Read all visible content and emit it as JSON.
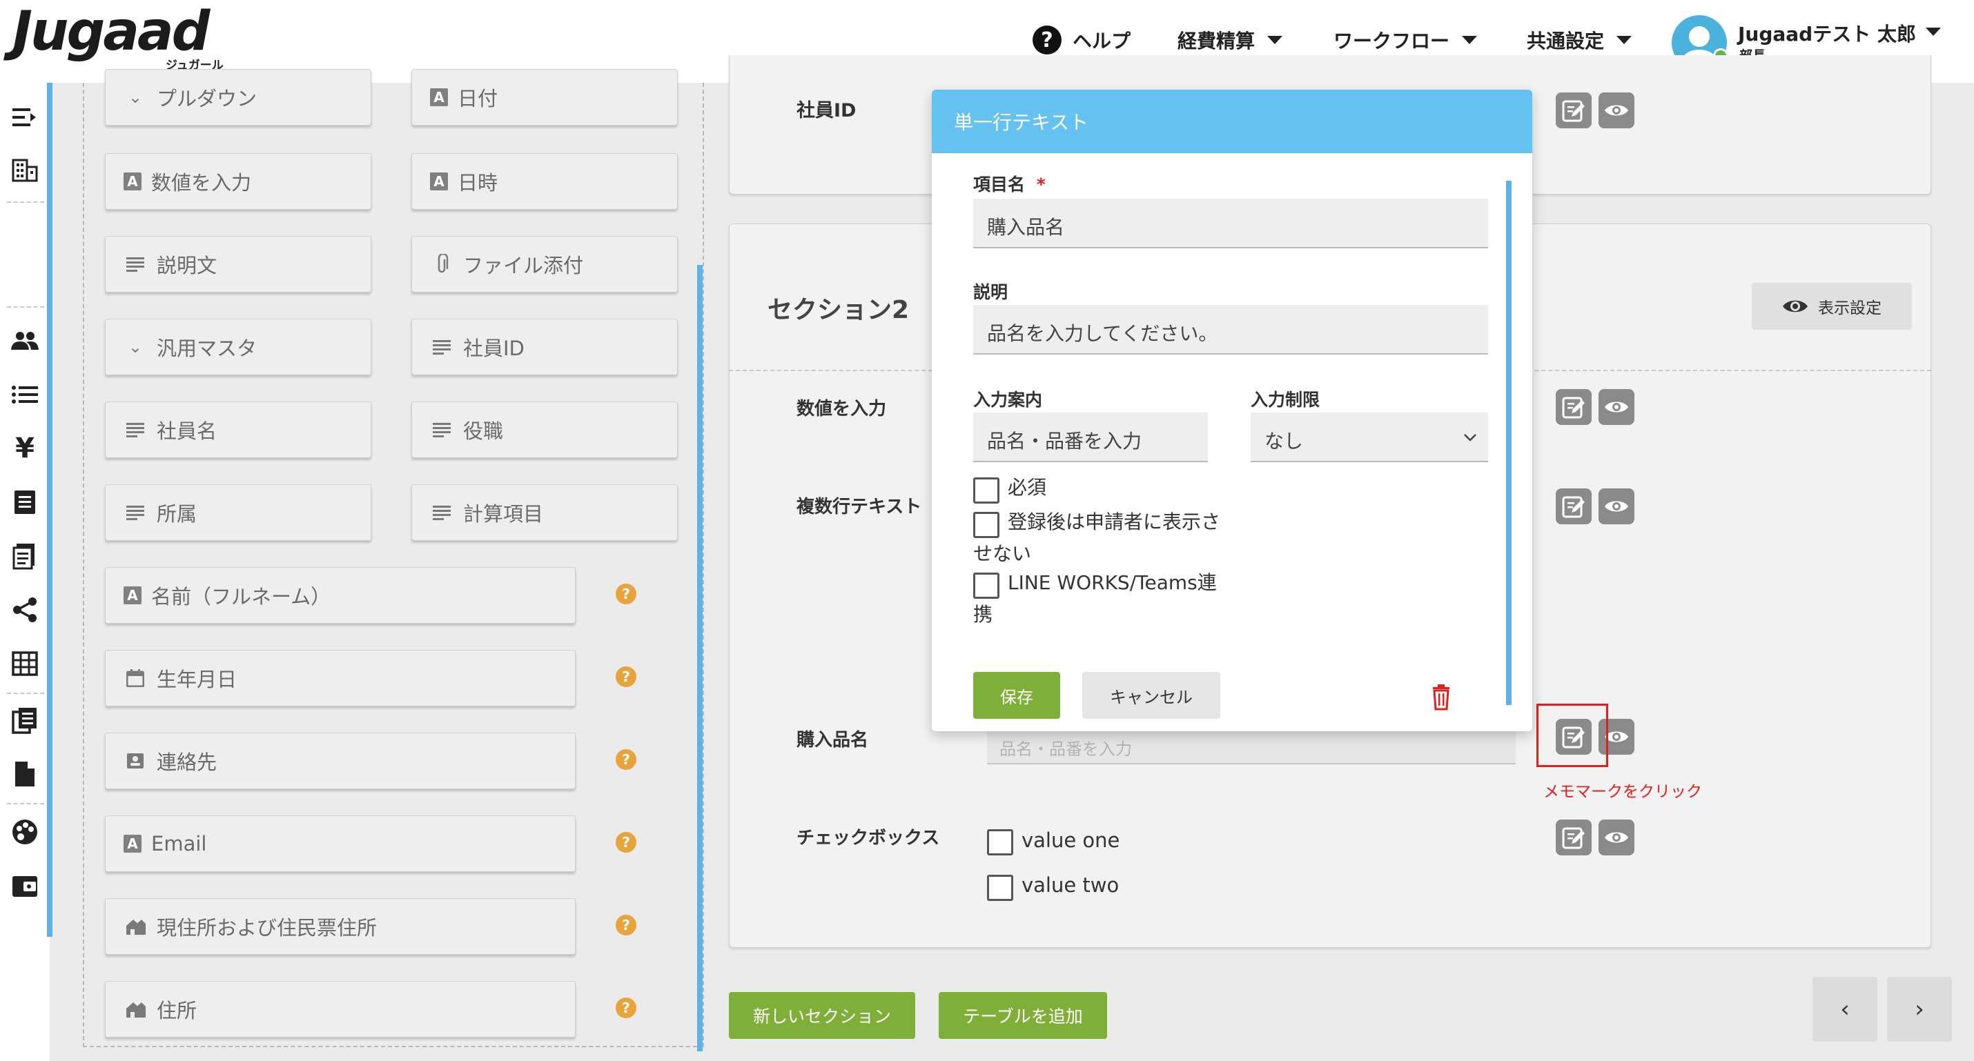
{
  "header": {
    "logo_text": "Jugaad",
    "logo_subtext": "ジュガール",
    "help_label": "ヘルプ",
    "help_glyph": "?",
    "menus": [
      "経費精算",
      "ワークフロー",
      "共通設定"
    ],
    "user_name": "Jugaadテスト 太郎",
    "user_role": "部長"
  },
  "sidebar": {
    "icons": [
      "collapse-menu-icon",
      "building-icon",
      "users-icon",
      "list-icon",
      "yen-icon",
      "receipt-icon",
      "document-icon",
      "share-icon",
      "table-icon",
      "books-icon",
      "file-icon",
      "palette-icon",
      "wallet-icon"
    ],
    "yen_glyph": "¥",
    "accent_color": "#5eb3e4"
  },
  "palette": {
    "items": [
      {
        "label": "プルダウン",
        "icon": "chevron-down-icon"
      },
      {
        "label": "日付",
        "icon": "text-a-icon"
      },
      {
        "label": "数値を入力",
        "icon": "text-a-icon"
      },
      {
        "label": "日時",
        "icon": "text-a-icon"
      },
      {
        "label": "説明文",
        "icon": "lines-icon"
      },
      {
        "label": "ファイル添付",
        "icon": "paperclip-icon"
      },
      {
        "label": "汎用マスタ",
        "icon": "chevron-down-icon"
      },
      {
        "label": "社員ID",
        "icon": "lines-icon"
      },
      {
        "label": "社員名",
        "icon": "lines-icon"
      },
      {
        "label": "役職",
        "icon": "lines-icon"
      },
      {
        "label": "所属",
        "icon": "lines-icon"
      },
      {
        "label": "計算項目",
        "icon": "lines-icon"
      }
    ],
    "wide_items": [
      {
        "label": "名前（フルネーム）",
        "icon": "text-a-icon"
      },
      {
        "label": "生年月日",
        "icon": "calendar-icon"
      },
      {
        "label": "連絡先",
        "icon": "contact-card-icon"
      },
      {
        "label": "Email",
        "icon": "text-a-icon"
      },
      {
        "label": "現住所および住民票住所",
        "icon": "house-icon"
      },
      {
        "label": "住所",
        "icon": "house-icon"
      }
    ],
    "a_glyph": "A",
    "help_glyph": "?",
    "chevron_glyph": "⌄",
    "help_color": "#e8a33b"
  },
  "form": {
    "top_field_label": "社員ID",
    "section_title": "セクション2",
    "display_settings_label": "表示設定",
    "fields": [
      {
        "label": "数値を入力"
      },
      {
        "label": "複数行テキスト"
      },
      {
        "label": "購入品名",
        "placeholder": "品名・品番を入力"
      },
      {
        "label": "チェックボックス",
        "options": [
          "value one",
          "value two"
        ]
      }
    ],
    "annotation": "メモマークをクリック",
    "annotation_color": "#e0201c",
    "new_section_label": "新しいセクション",
    "add_table_label": "テーブルを追加",
    "prev_glyph": "‹",
    "next_glyph": "›"
  },
  "modal": {
    "title": "単一行テキスト",
    "item_name_label": "項目名",
    "required_mark": "*",
    "item_name_value": "購入品名",
    "description_label": "説明",
    "description_value": "品名を入力してください。",
    "guide_label": "入力案内",
    "guide_value": "品名・品番を入力",
    "restriction_label": "入力制限",
    "restriction_value": "なし",
    "checkboxes": [
      {
        "label": "必須",
        "checked": false
      },
      {
        "label": "登録後は申請者に表示させない",
        "checked": false
      },
      {
        "label": "LINE WORKS/Teams連携",
        "checked": false
      }
    ],
    "save_label": "保存",
    "cancel_label": "キャンセル",
    "header_color": "#63c2ef",
    "save_color": "#7fae39"
  }
}
